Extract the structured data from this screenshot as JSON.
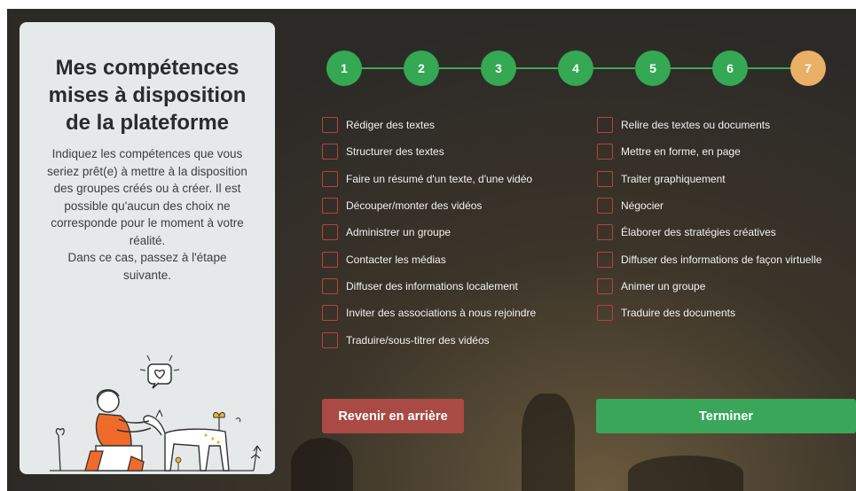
{
  "panel": {
    "title_lines": [
      "Mes compétences",
      "mises à disposition",
      "de la plateforme"
    ],
    "description_lines": [
      "Indiquez les compétences que vous",
      "seriez prêt(e) à mettre à la disposition",
      "des groupes créés ou à créer. Il est",
      "possible qu'aucun des choix ne",
      "corresponde pour le moment à votre",
      "réalité.",
      "Dans ce cas, passez à l'étape",
      "suivante."
    ]
  },
  "stepper": {
    "steps": [
      "1",
      "2",
      "3",
      "4",
      "5",
      "6",
      "7"
    ],
    "current_step": 7,
    "colors": {
      "done": "#34a853",
      "current": "#e9b066"
    }
  },
  "skills_left": [
    "Rédiger des textes",
    "Structurer des textes",
    "Faire un résumé d'un texte, d'une vidéo",
    "Découper/monter des vidéos",
    "Administrer un groupe",
    "Contacter les médias",
    "Diffuser des informations localement",
    "Inviter des associations à nous rejoindre",
    "Traduire/sous-titrer des vidéos"
  ],
  "skills_right": [
    "Relire des textes ou documents",
    "Mettre en forme, en page",
    "Traiter graphiquement",
    "Négocier",
    "Élaborer des stratégies créatives",
    "Diffuser des informations de façon virtuelle",
    "Animer un groupe",
    "Traduire des documents"
  ],
  "buttons": {
    "back_label": "Revenir en arrière",
    "finish_label": "Terminer",
    "back_color": "#a94a44",
    "finish_color": "#3aa65a"
  },
  "icons": {
    "illustration": "woman-with-deer-illustration",
    "checkbox": "checkbox-icon"
  }
}
